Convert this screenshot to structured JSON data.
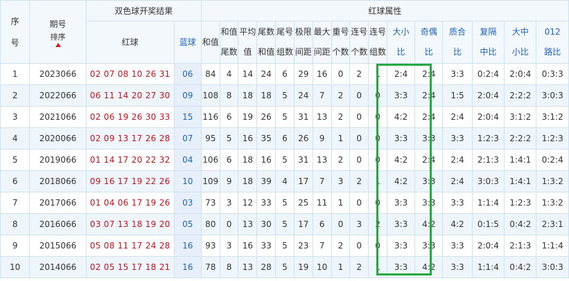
{
  "header": {
    "xuhao": [
      "序",
      "号"
    ],
    "qihao": "期号",
    "sort_label": "排序",
    "draw_group": "双色球开奖结果",
    "red_group": "红球属性",
    "red_ball": "红球",
    "blue_ball": "蓝球",
    "hezhi": "和值",
    "hezhi_weishu": [
      "和值",
      "尾数"
    ],
    "pingjun": [
      "平均",
      "值"
    ],
    "weishu_hezhi": [
      "尾数",
      "和值"
    ],
    "weihao_zushu": [
      "尾号",
      "组数"
    ],
    "jixian_jianju": [
      "极限",
      "间距"
    ],
    "zuida_jianju": [
      "最大",
      "间距"
    ],
    "chonghao_geshu": [
      "重号",
      "个数"
    ],
    "lianhao_geshu": [
      "连号",
      "个数"
    ],
    "lianhao_zushu": [
      "连号",
      "组数"
    ],
    "daxiao": [
      "大小",
      "比"
    ],
    "jiou": [
      "奇偶",
      "比"
    ],
    "zhihe": [
      "质合",
      "比"
    ],
    "fugezhong": [
      "复隔",
      "中比"
    ],
    "dazhongxiao": [
      "大中",
      "小比"
    ],
    "lubi012": [
      "012",
      "路比"
    ]
  },
  "colors": {
    "red_ball": "#c0141c",
    "blue_ball": "#1f63b7",
    "highlight_box": "#26a845",
    "sort_arrow": "#d8141c"
  },
  "rows": [
    {
      "no": "1",
      "issue": "2023066",
      "red": "02 07 08 10 26 31",
      "blue": "06",
      "sum": "84",
      "sum_tail": "4",
      "avg": "14",
      "tail_sum": "24",
      "tail_groups": "6",
      "extreme_span": "29",
      "max_span": "16",
      "repeat": "0",
      "consec": "2",
      "consec_groups": "1",
      "big_small": "2:4",
      "odd_even": "2:4",
      "prime": "3:3",
      "fgz": "0:2:4",
      "dzx": "2:0:4",
      "lu012": "0:3:3"
    },
    {
      "no": "2",
      "issue": "2022066",
      "red": "06 11 14 20 27 30",
      "blue": "09",
      "sum": "108",
      "sum_tail": "8",
      "avg": "18",
      "tail_sum": "18",
      "tail_groups": "5",
      "extreme_span": "24",
      "max_span": "7",
      "repeat": "2",
      "consec": "0",
      "consec_groups": "0",
      "big_small": "3:3",
      "odd_even": "2:4",
      "prime": "1:5",
      "fgz": "2:0:4",
      "dzx": "2:2:2",
      "lu012": "3:0:3"
    },
    {
      "no": "3",
      "issue": "2021066",
      "red": "02 06 19 26 30 33",
      "blue": "15",
      "sum": "116",
      "sum_tail": "6",
      "avg": "19",
      "tail_sum": "26",
      "tail_groups": "5",
      "extreme_span": "31",
      "max_span": "13",
      "repeat": "2",
      "consec": "0",
      "consec_groups": "0",
      "big_small": "4:2",
      "odd_even": "2:4",
      "prime": "2:4",
      "fgz": "2:0:4",
      "dzx": "3:1:2",
      "lu012": "3:1:2"
    },
    {
      "no": "4",
      "issue": "2020066",
      "red": "02 09 13 17 26 28",
      "blue": "07",
      "sum": "95",
      "sum_tail": "5",
      "avg": "16",
      "tail_sum": "35",
      "tail_groups": "6",
      "extreme_span": "26",
      "max_span": "9",
      "repeat": "1",
      "consec": "0",
      "consec_groups": "0",
      "big_small": "3:3",
      "odd_even": "3:3",
      "prime": "3:3",
      "fgz": "1:2:3",
      "dzx": "2:2:2",
      "lu012": "1:2:3"
    },
    {
      "no": "5",
      "issue": "2019066",
      "red": "01 14 17 20 22 32",
      "blue": "04",
      "sum": "106",
      "sum_tail": "6",
      "avg": "18",
      "tail_sum": "16",
      "tail_groups": "5",
      "extreme_span": "31",
      "max_span": "13",
      "repeat": "2",
      "consec": "0",
      "consec_groups": "0",
      "big_small": "4:2",
      "odd_even": "2:4",
      "prime": "2:4",
      "fgz": "2:1:3",
      "dzx": "1:4:1",
      "lu012": "0:2:4"
    },
    {
      "no": "6",
      "issue": "2018066",
      "red": "09 16 17 19 22 26",
      "blue": "10",
      "sum": "109",
      "sum_tail": "9",
      "avg": "18",
      "tail_sum": "39",
      "tail_groups": "4",
      "extreme_span": "17",
      "max_span": "7",
      "repeat": "3",
      "consec": "2",
      "consec_groups": "1",
      "big_small": "4:2",
      "odd_even": "3:3",
      "prime": "2:4",
      "fgz": "3:0:3",
      "dzx": "1:4:1",
      "lu012": "1:3:2"
    },
    {
      "no": "7",
      "issue": "2017066",
      "red": "01 04 06 17 19 26",
      "blue": "03",
      "sum": "73",
      "sum_tail": "3",
      "avg": "12",
      "tail_sum": "33",
      "tail_groups": "5",
      "extreme_span": "25",
      "max_span": "11",
      "repeat": "1",
      "consec": "0",
      "consec_groups": "0",
      "big_small": "3:3",
      "odd_even": "3:3",
      "prime": "3:3",
      "fgz": "1:1:4",
      "dzx": "1:2:3",
      "lu012": "1:3:2"
    },
    {
      "no": "8",
      "issue": "2016066",
      "red": "03 07 13 18 19 20",
      "blue": "05",
      "sum": "80",
      "sum_tail": "0",
      "avg": "13",
      "tail_sum": "30",
      "tail_groups": "5",
      "extreme_span": "17",
      "max_span": "6",
      "repeat": "0",
      "consec": "3",
      "consec_groups": "2",
      "big_small": "3:3",
      "odd_even": "4:2",
      "prime": "4:2",
      "fgz": "0:1:5",
      "dzx": "0:4:2",
      "lu012": "2:3:1"
    },
    {
      "no": "9",
      "issue": "2015066",
      "red": "05 08 11 17 24 28",
      "blue": "16",
      "sum": "93",
      "sum_tail": "3",
      "avg": "16",
      "tail_sum": "33",
      "tail_groups": "5",
      "extreme_span": "23",
      "max_span": "7",
      "repeat": "2",
      "consec": "0",
      "consec_groups": "0",
      "big_small": "3:3",
      "odd_even": "3:3",
      "prime": "3:3",
      "fgz": "2:0:4",
      "dzx": "2:1:3",
      "lu012": "1:1:4"
    },
    {
      "no": "10",
      "issue": "2014066",
      "red": "02 05 15 17 18 21",
      "blue": "16",
      "sum": "78",
      "sum_tail": "8",
      "avg": "13",
      "tail_sum": "28",
      "tail_groups": "5",
      "extreme_span": "19",
      "max_span": "10",
      "repeat": "1",
      "consec": "2",
      "consec_groups": "1",
      "big_small": "3:3",
      "odd_even": "4:2",
      "prime": "3:3",
      "fgz": "1:1:4",
      "dzx": "0:4:2",
      "lu012": "3:0:3"
    }
  ]
}
